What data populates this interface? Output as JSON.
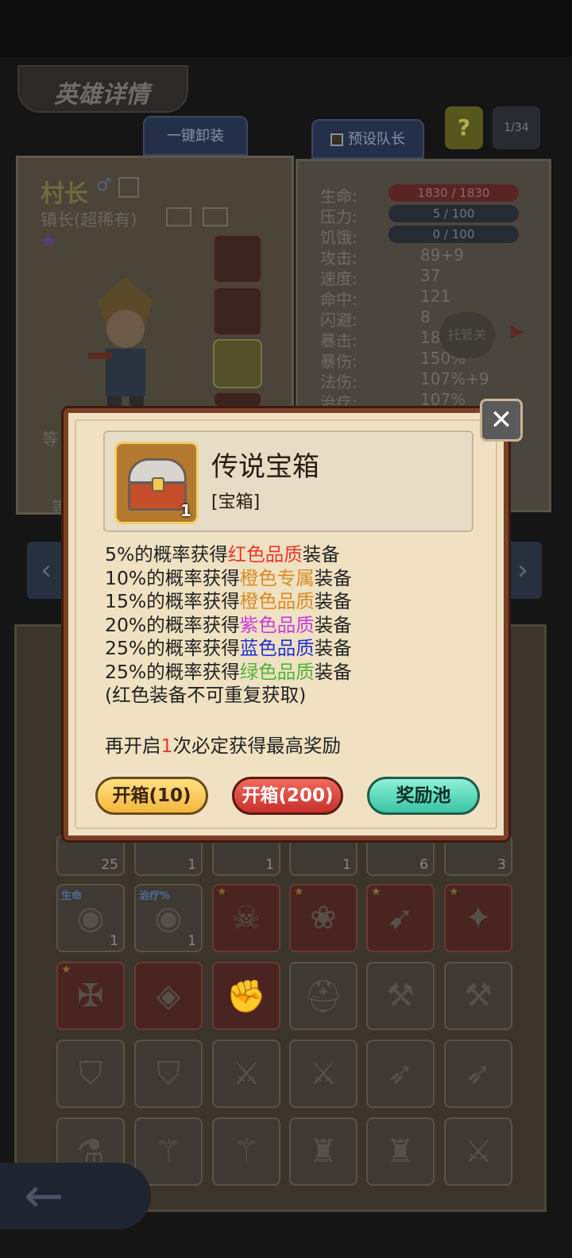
{
  "background": {
    "page_title": "英雄详情",
    "unequip_all": "一键卸装",
    "preset_captain": "预设队长",
    "help": "?",
    "page_indicator": "1/34",
    "hero": {
      "name": "村长",
      "class": "镇长(超稀有)",
      "level_label_1": "等",
      "level_label_2": "等"
    },
    "stats": [
      {
        "label": "生命:",
        "value": ""
      },
      {
        "label": "压力:",
        "value": ""
      },
      {
        "label": "饥饿:",
        "value": ""
      },
      {
        "label": "攻击:",
        "value": "89+9"
      },
      {
        "label": "速度:",
        "value": "37"
      },
      {
        "label": "命中:",
        "value": "121"
      },
      {
        "label": "闪避:",
        "value": "8"
      },
      {
        "label": "暴击:",
        "value": "18"
      },
      {
        "label": "暴伤:",
        "value": "150%"
      },
      {
        "label": "法伤:",
        "value": "107%+9"
      },
      {
        "label": "治疗:",
        "value": "107%"
      }
    ],
    "bars": {
      "hp": "1830 / 1830",
      "stress": "5 / 100",
      "hunger": "0 / 100"
    },
    "auto_button": "托管关",
    "inventory_counts": [
      "25",
      "1",
      "1",
      "1",
      "6",
      "3",
      "1",
      "1"
    ],
    "inventory_tags": [
      "生命",
      "治疗%"
    ]
  },
  "modal": {
    "item_name": "传说宝箱",
    "item_type": "[宝箱]",
    "item_qty": "1",
    "lines": [
      {
        "pre": "5%的概率获得",
        "hl": "红色品质",
        "post": "装备"
      },
      {
        "pre": "10%的概率获得",
        "hl": "橙色专属",
        "post": "装备"
      },
      {
        "pre": "15%的概率获得",
        "hl": "橙色品质",
        "post": "装备"
      },
      {
        "pre": "20%的概率获得",
        "hl": "紫色品质",
        "post": "装备"
      },
      {
        "pre": "25%的概率获得",
        "hl": "蓝色品质",
        "post": "装备"
      },
      {
        "pre": "25%的概率获得",
        "hl": "绿色品质",
        "post": "装备"
      }
    ],
    "note": "(红色装备不可重复获取)",
    "guarantee": {
      "pre": "再开启",
      "num": "1",
      "post": "次必定获得最高奖励"
    },
    "buttons": {
      "open10": "开箱(10)",
      "open200": "开箱(200)",
      "pool": "奖励池"
    },
    "colors": {
      "red": "#e8382f",
      "orange": "#d98b29",
      "purple": "#c93ae0",
      "blue": "#2230d6",
      "green": "#4fb43c"
    }
  }
}
